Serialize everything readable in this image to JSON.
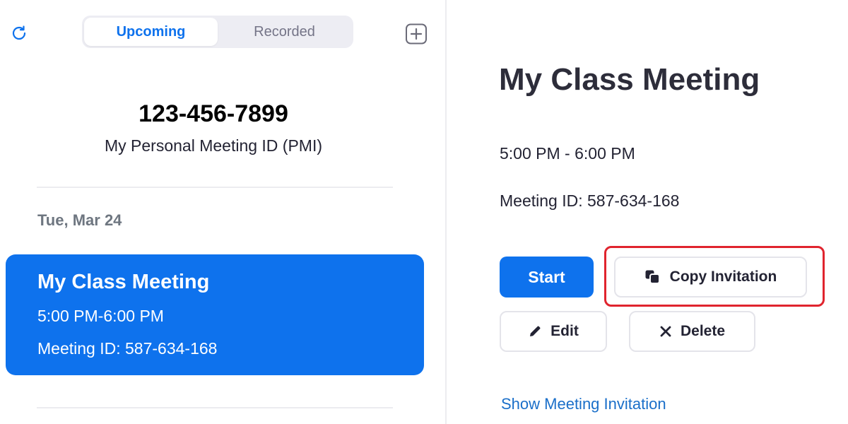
{
  "header": {
    "tabs": [
      {
        "label": "Upcoming",
        "active": true
      },
      {
        "label": "Recorded",
        "active": false
      }
    ],
    "refresh_icon": "refresh-icon",
    "add_icon": "add-meeting-icon"
  },
  "pmi": {
    "number": "123-456-7899",
    "label": "My Personal Meeting ID (PMI)"
  },
  "meeting_list": {
    "date": "Tue, Mar 24",
    "items": [
      {
        "title": "My Class Meeting",
        "time": "5:00 PM-6:00 PM",
        "meeting_id": "Meeting ID: 587-634-168",
        "selected": true
      }
    ]
  },
  "detail": {
    "title": "My Class Meeting",
    "time": "5:00 PM - 6:00 PM",
    "meeting_id": "Meeting ID: 587-634-168",
    "buttons": {
      "start": "Start",
      "copy_invitation": "Copy Invitation",
      "edit": "Edit",
      "delete": "Delete"
    },
    "show_invitation_link": "Show Meeting Invitation"
  },
  "colors": {
    "accent": "#0e72ed",
    "highlight": "#e0242e",
    "link": "#1a6fc9"
  }
}
